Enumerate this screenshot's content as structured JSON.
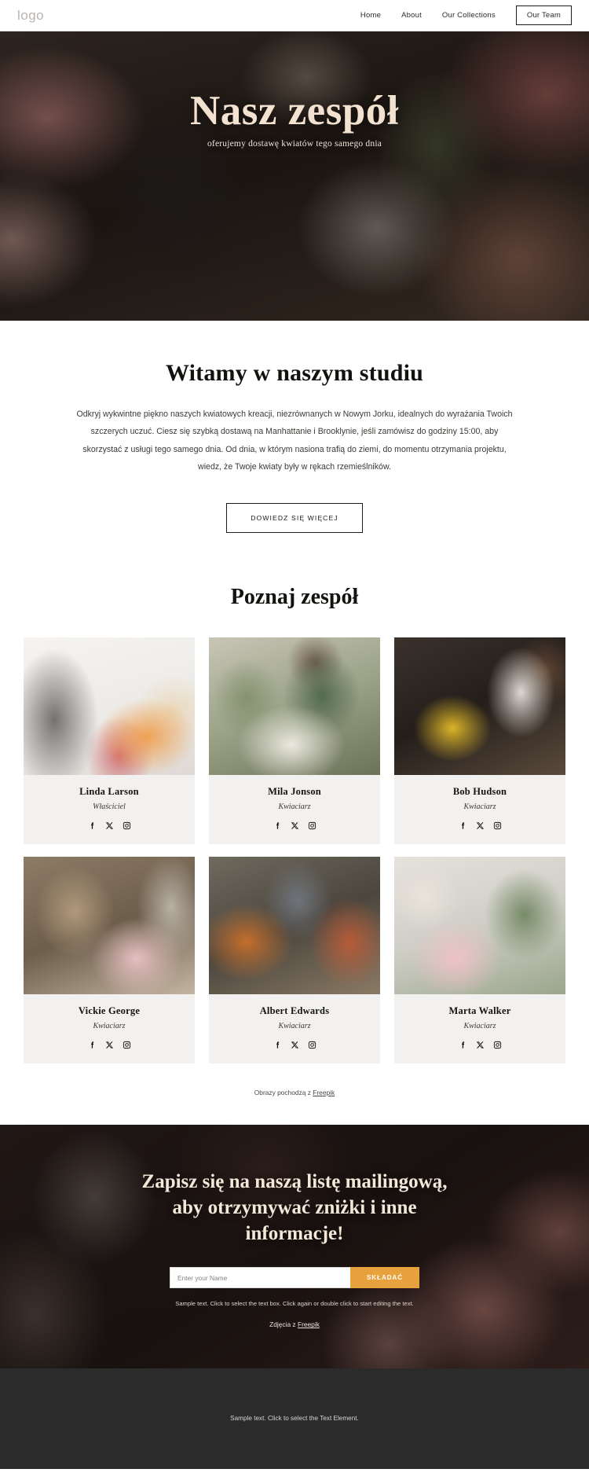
{
  "header": {
    "logo": "logo",
    "nav": [
      {
        "label": "Home",
        "boxed": false
      },
      {
        "label": "About",
        "boxed": false
      },
      {
        "label": "Our Collections",
        "boxed": false
      },
      {
        "label": "Our Team",
        "boxed": true
      }
    ]
  },
  "hero": {
    "title": "Nasz zespół",
    "subtitle": "oferujemy dostawę kwiatów tego samego dnia"
  },
  "welcome": {
    "title": "Witamy w naszym studiu",
    "paragraph": "Odkryj wykwintne piękno naszych kwiatowych kreacji, niezrównanych w Nowym Jorku, idealnych do wyrażania Twoich szczerych uczuć. Ciesz się szybką dostawą na Manhattanie i Brooklynie, jeśli zamówisz do godziny 15:00, aby skorzystać z usługi tego samego dnia. Od dnia, w którym nasiona trafią do ziemi, do momentu otrzymania projektu, wiedz, że Twoje kwiaty były w rękach rzemieślników.",
    "button": "DOWIEDZ SIĘ WIĘCEJ"
  },
  "team": {
    "title": "Poznaj zespół",
    "members": [
      {
        "name": "Linda Larson",
        "role": "Właściciel"
      },
      {
        "name": "Mila Jonson",
        "role": "Kwiaciarz"
      },
      {
        "name": "Bob Hudson",
        "role": "Kwiaciarz"
      },
      {
        "name": "Vickie George",
        "role": "Kwiaciarz"
      },
      {
        "name": "Albert Edwards",
        "role": "Kwiaciarz"
      },
      {
        "name": "Marta Walker",
        "role": "Kwiaciarz"
      }
    ],
    "socials": [
      "facebook-icon",
      "x-twitter-icon",
      "instagram-icon"
    ],
    "credit_text": "Obrazy pochodzą z ",
    "credit_link": "Freepik"
  },
  "newsletter": {
    "title": "Zapisz się na naszą listę mailingową, aby otrzymywać zniżki i inne informacje!",
    "input_placeholder": "Enter your Name",
    "input_value": "",
    "submit_label": "SKŁADAĆ",
    "note": "Sample text. Click to select the text box. Click again or double click to start editing the text.",
    "credit_text": "Zdjęcia z ",
    "credit_link": "Freepik",
    "accent_color": "#e7a23d"
  },
  "footer": {
    "text": "Sample text. Click to select the Text Element."
  }
}
